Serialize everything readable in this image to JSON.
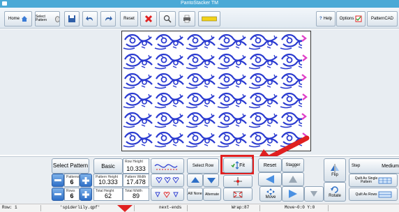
{
  "window": {
    "title": "PantoStacker TM"
  },
  "toolbar": {
    "home_label": "Home",
    "select_pattern_label": "Select Pattern",
    "reset_label": "Reset",
    "help_label": "Help",
    "options_label": "Options",
    "patterncad_label": "PatternCAD"
  },
  "panel": {
    "select_pattern_label": "Select Pattern",
    "patterns_label": "Patterns",
    "patterns_value": "6",
    "rows_label": "Rows",
    "rows_value": "6",
    "basic_label": "Basic",
    "row_height_label": "Row Height",
    "row_height_value": "10.333",
    "pattern_height_label": "Pattern Height",
    "pattern_height_value": "10.333",
    "pattern_width_label": "Pattern Width",
    "pattern_width_value": "17.478",
    "total_height_label": "Total Height",
    "total_height_value": "62",
    "total_width_label": "Total Width",
    "total_width_value": "89",
    "select_row_label": "Select Row",
    "all_none_label": "All/ None",
    "alternate_label": "Alternate",
    "fit_label": "Fit",
    "reset_label": "Reset",
    "stagger_label": "Stagger",
    "move_label": "Move",
    "flip_label": "Flip",
    "rotate_label": "Rotate",
    "step_label": "Step",
    "medium_label": "Medium",
    "quilt_single_label": "Quilt As Single Pattern",
    "quilt_rows_label": "Quilt As Rows"
  },
  "status": {
    "row": "Row: 1",
    "file": "'spiderlily.qpf'",
    "ends": "next-ends",
    "wrap": "Wrap:87",
    "move": "Move~0:0 Y:0"
  },
  "colors": {
    "titlebar": "#4aa9d6",
    "pattern_blue": "#2b3bd0",
    "pattern_pink": "#e040c8",
    "highlight_red": "#e02020",
    "arrow_blue": "#2e6fc7"
  }
}
